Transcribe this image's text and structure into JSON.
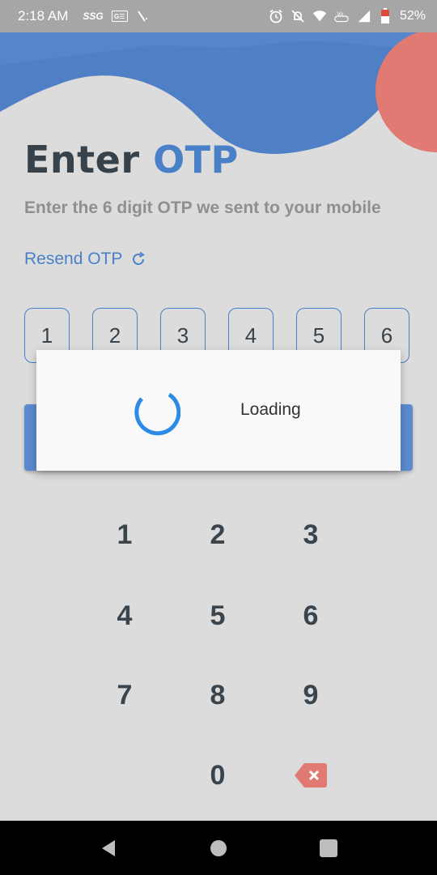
{
  "status_bar": {
    "time": "2:18 AM",
    "left_icons": [
      "ssg-icon",
      "gmail-icon",
      "signal-slash-icon"
    ],
    "ssg_text": "SSG",
    "gmail_text": "G☰",
    "right_icons": [
      "alarm-icon",
      "mute-icon",
      "wifi-icon",
      "volte-icon",
      "signal-icon",
      "battery-icon"
    ],
    "battery": "52%"
  },
  "colors": {
    "accent": "#4a80c8",
    "coral": "#e07a72",
    "background": "#dcdcdc",
    "button": "#5b8ad0"
  },
  "header": {
    "title_part1": "Enter",
    "title_part2": "OTP",
    "subtitle": "Enter the 6 digit OTP we sent to your mobile",
    "resend_label": "Resend OTP"
  },
  "otp_digits": [
    "1",
    "2",
    "3",
    "4",
    "5",
    "6"
  ],
  "dialog": {
    "text": "Loading"
  },
  "keypad": {
    "keys": [
      "1",
      "2",
      "3",
      "4",
      "5",
      "6",
      "7",
      "8",
      "9",
      "0"
    ],
    "backspace_icon": "backspace-icon"
  },
  "nav": {
    "icons": [
      "back-icon",
      "home-icon",
      "recents-icon"
    ]
  }
}
